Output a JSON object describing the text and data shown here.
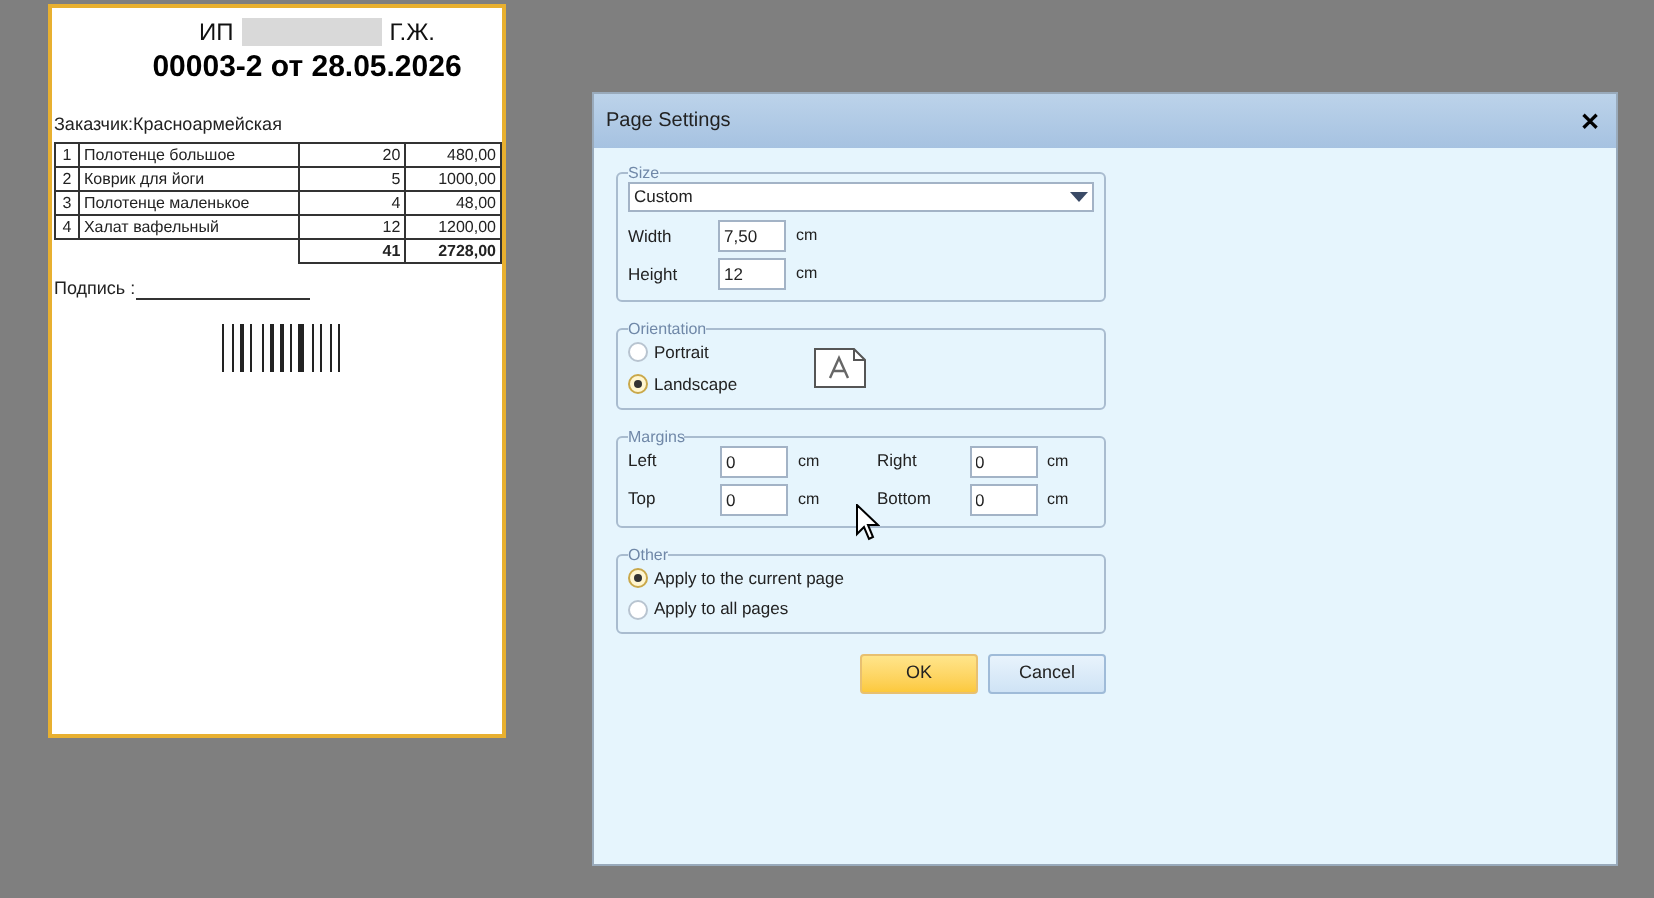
{
  "document": {
    "header_prefix": "ИП",
    "header_suffix": "Г.Ж.",
    "title": "00003-2 от 28.05.2026",
    "customer": "Заказчик:Красноармейская",
    "rows": [
      {
        "no": "1",
        "name": "Полотенце большое",
        "qty": "20",
        "sum": "480,00"
      },
      {
        "no": "2",
        "name": "Коврик для йоги",
        "qty": "5",
        "sum": "1000,00"
      },
      {
        "no": "3",
        "name": "Полотенце маленькое",
        "qty": "4",
        "sum": "48,00"
      },
      {
        "no": "4",
        "name": "Халат вафельный",
        "qty": "12",
        "sum": "1200,00"
      }
    ],
    "total_qty": "41",
    "total_sum": "2728,00",
    "signature": "Подпись :"
  },
  "dialog": {
    "title": "Page Settings",
    "close": "✕",
    "size": {
      "legend": "Size",
      "dropdown": "Custom",
      "fields": [
        {
          "label": "Width",
          "value": "7,50",
          "unit": "cm"
        },
        {
          "label": "Height",
          "value": "12",
          "unit": "cm"
        }
      ]
    },
    "orientation": {
      "legend": "Orientation",
      "options": [
        {
          "label": "Portrait",
          "selected": false
        },
        {
          "label": "Landscape",
          "selected": true
        }
      ]
    },
    "margins": {
      "legend": "Margins",
      "fields": [
        {
          "label": "Left",
          "value": "0",
          "unit": "cm"
        },
        {
          "label": "Right",
          "value": "0",
          "unit": "cm"
        },
        {
          "label": "Top",
          "value": "0",
          "unit": "cm"
        },
        {
          "label": "Bottom",
          "value": "0",
          "unit": "cm"
        }
      ]
    },
    "other": {
      "legend": "Other",
      "options": [
        {
          "label": "Apply to the current page",
          "selected": true
        },
        {
          "label": "Apply to all pages",
          "selected": false
        }
      ]
    },
    "buttons": [
      {
        "label": "OK",
        "kind": "default"
      },
      {
        "label": "Cancel",
        "kind": "normal"
      }
    ]
  }
}
